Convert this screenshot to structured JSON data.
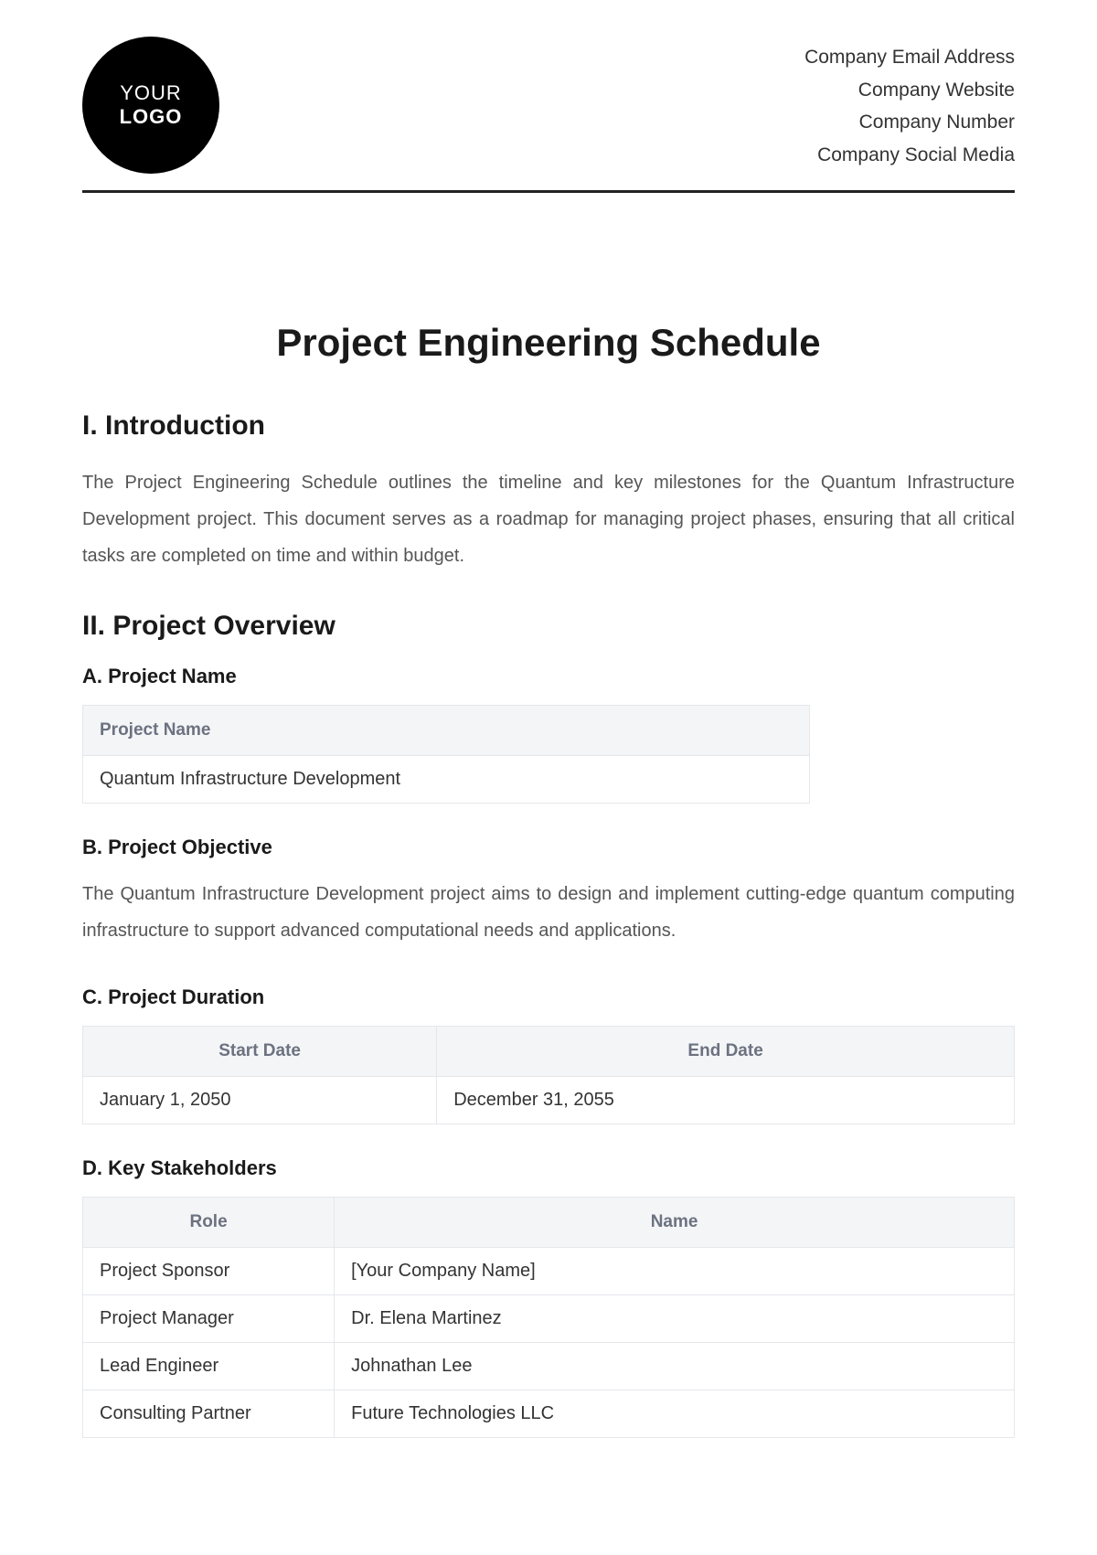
{
  "header": {
    "logo_line1": "YOUR",
    "logo_line2": "LOGO",
    "company_email": "Company Email Address",
    "company_website": "Company Website",
    "company_number": "Company Number",
    "company_social": "Company Social Media"
  },
  "title": "Project Engineering Schedule",
  "section1": {
    "heading": "I. Introduction",
    "body": "The Project Engineering Schedule outlines the timeline and key milestones for the Quantum Infrastructure Development project. This document serves as a roadmap for managing project phases, ensuring that all critical tasks are completed on time and within budget."
  },
  "section2": {
    "heading": "II. Project Overview",
    "subA": {
      "heading": "A. Project Name",
      "table_header": "Project Name",
      "value": "Quantum Infrastructure Development"
    },
    "subB": {
      "heading": "B. Project Objective",
      "body": "The Quantum Infrastructure Development project aims to design and implement cutting-edge quantum computing infrastructure to support advanced computational needs and applications."
    },
    "subC": {
      "heading": "C. Project Duration",
      "header_start": "Start Date",
      "header_end": "End Date",
      "start_date": "January 1, 2050",
      "end_date": "December 31, 2055"
    },
    "subD": {
      "heading": "D. Key Stakeholders",
      "header_role": "Role",
      "header_name": "Name",
      "rows": [
        {
          "role": "Project Sponsor",
          "name": "[Your Company Name]"
        },
        {
          "role": "Project Manager",
          "name": "Dr. Elena Martinez"
        },
        {
          "role": "Lead Engineer",
          "name": "Johnathan Lee"
        },
        {
          "role": "Consulting Partner",
          "name": "Future Technologies LLC"
        }
      ]
    }
  }
}
